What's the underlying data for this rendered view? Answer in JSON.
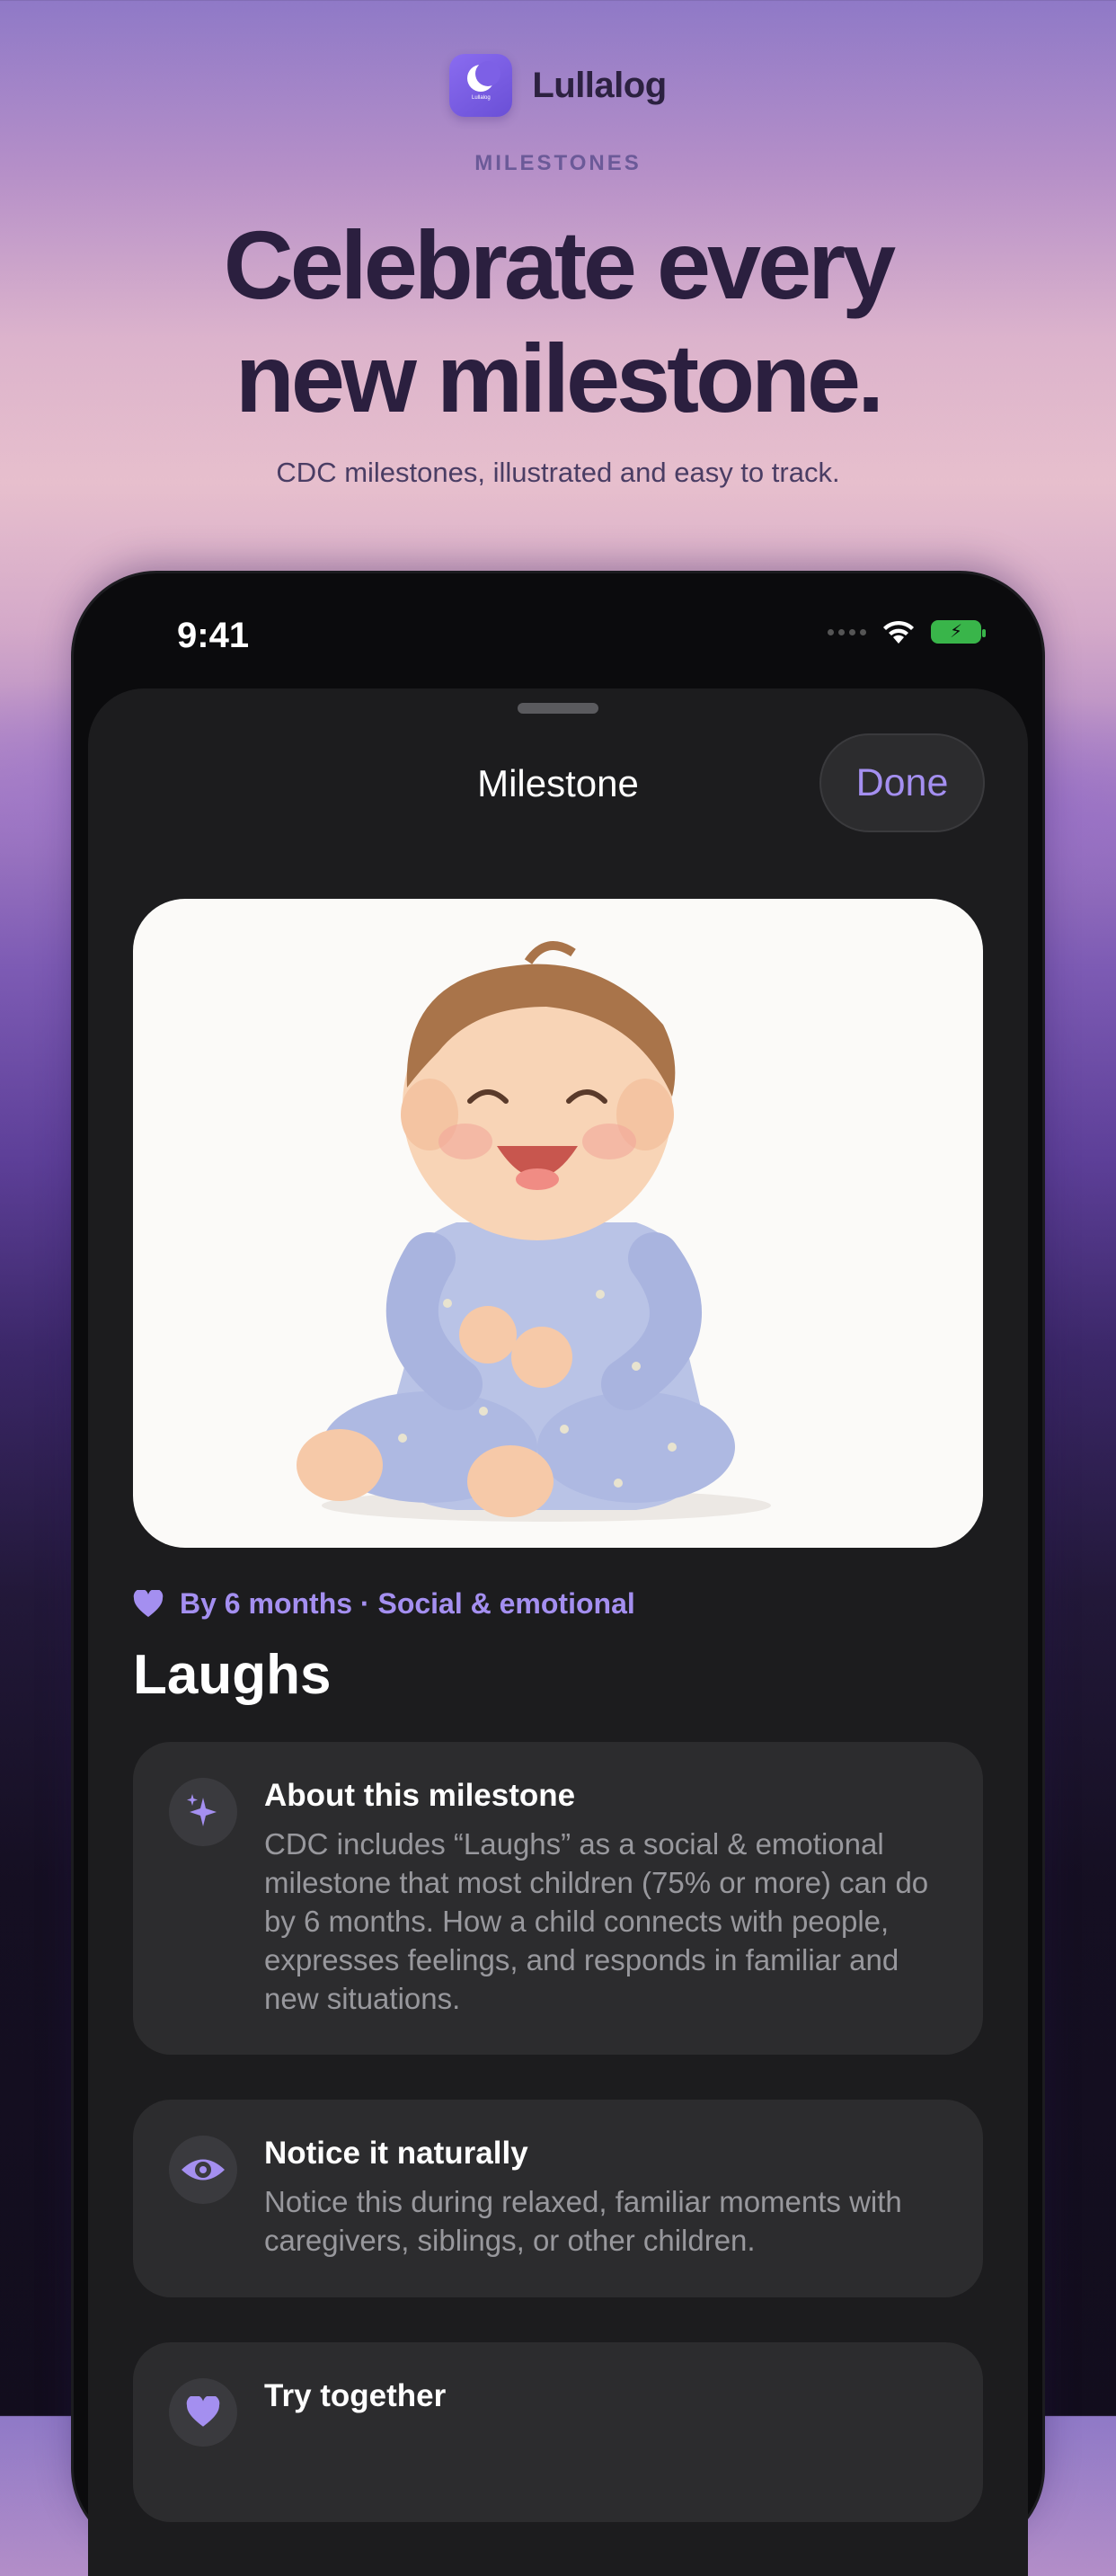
{
  "brand": {
    "app_name": "Lullalog",
    "icon_caption": "Lullalog"
  },
  "hero_copy": {
    "eyebrow": "MILESTONES",
    "headline_line1": "Celebrate every",
    "headline_line2": "new milestone.",
    "subhead": "CDC milestones, illustrated and easy to track."
  },
  "status_bar": {
    "time": "9:41",
    "battery": "charging"
  },
  "sheet": {
    "title": "Milestone",
    "done_label": "Done",
    "image": "baby-laughing-illustration",
    "meta_icon": "heart-icon",
    "meta": "By 6 months · Social & emotional",
    "milestone_name": "Laughs"
  },
  "cards": [
    {
      "icon": "sparkles-icon",
      "title": "About this milestone",
      "body": "CDC includes “Laughs” as a social & emotional milestone that most children (75% or more) can do by 6 months. How a child connects with people, expresses feelings, and responds in familiar and new situations."
    },
    {
      "icon": "eye-icon",
      "title": "Notice it naturally",
      "body": "Notice this during relaxed, familiar moments with caregivers, siblings, or other children."
    },
    {
      "icon": "heart-icon",
      "title": "Try together",
      "body": ""
    }
  ],
  "colors": {
    "accent": "#a48ff0",
    "sheet_bg": "#1c1c1e",
    "card_bg": "#2c2c2e",
    "headline": "#2b1f3f"
  }
}
